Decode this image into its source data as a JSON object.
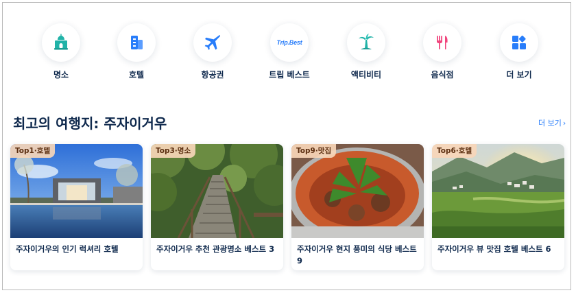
{
  "categories": [
    {
      "label": "명소",
      "icon": "attraction-icon"
    },
    {
      "label": "호텔",
      "icon": "hotel-building-icon"
    },
    {
      "label": "항공권",
      "icon": "airplane-icon"
    },
    {
      "label": "트립 베스트",
      "icon": "trip-best-logo",
      "logo_text": "Trip.Best"
    },
    {
      "label": "액티비티",
      "icon": "palm-tree-icon"
    },
    {
      "label": "음식점",
      "icon": "fork-knife-icon"
    },
    {
      "label": "더 보기",
      "icon": "grid-more-icon"
    }
  ],
  "section": {
    "title": "최고의 여행지: 주자이거우",
    "more_label": "더 보기"
  },
  "cards": [
    {
      "badge": "Top1·호텔",
      "title": "주자이거우의 인기 럭셔리 호텔",
      "image": "hotel-pool-photo"
    },
    {
      "badge": "Top3·명소",
      "title": "주자이거우 추천 관광명소 베스트 3",
      "image": "forest-stairs-photo"
    },
    {
      "badge": "Top9·맛집",
      "title": "주자이거우 현지 풍미의 식당 베스트 9",
      "image": "spicy-hotpot-photo"
    },
    {
      "badge": "Top6·호텔",
      "title": "주자이거우 뷰 맛집 호텔 베스트 6",
      "image": "mountain-valley-photo"
    }
  ],
  "colors": {
    "brand_blue": "#287dfa",
    "text_dark": "#0f294d",
    "badge_bg": "#f7d6b8",
    "teal": "#21b3a8",
    "pink": "#f0457d"
  }
}
